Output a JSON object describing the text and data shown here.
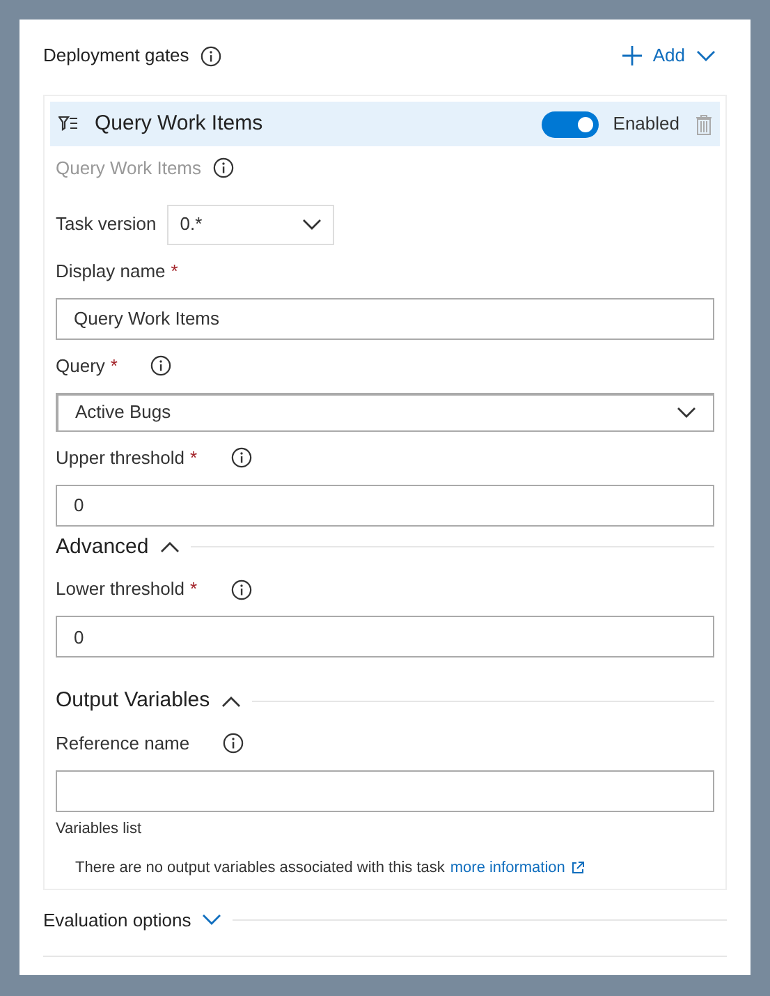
{
  "header": {
    "title": "Deployment gates",
    "add_label": "Add"
  },
  "gate": {
    "name": "Query Work Items",
    "enabled": true,
    "enabled_label": "Enabled",
    "subtitle": "Query Work Items",
    "rows": [
      {
        "kind": "inline-select",
        "label": "Task version",
        "value": "0.*"
      },
      {
        "kind": "input",
        "label": "Display name",
        "required_mark": "*",
        "info": false,
        "value": "Query Work Items"
      },
      {
        "kind": "select",
        "label": "Query",
        "required_mark": "*",
        "info": true,
        "value": "Active Bugs"
      },
      {
        "kind": "input",
        "label": "Upper threshold",
        "required_mark": "*",
        "info": true,
        "value": "0"
      },
      {
        "kind": "section",
        "label": "Advanced",
        "expanded": true
      },
      {
        "kind": "input",
        "label": "Lower threshold",
        "required_mark": "*",
        "info": true,
        "value": "0"
      },
      {
        "kind": "section",
        "label": "Output Variables",
        "expanded": true
      },
      {
        "kind": "input",
        "label": "Reference name",
        "info": true
      },
      {
        "kind": "list",
        "label": "Variables list",
        "message": "There are no output variables associated with this task",
        "link": "more information"
      }
    ]
  },
  "footer_section": {
    "label": "Evaluation options",
    "expanded": false
  }
}
